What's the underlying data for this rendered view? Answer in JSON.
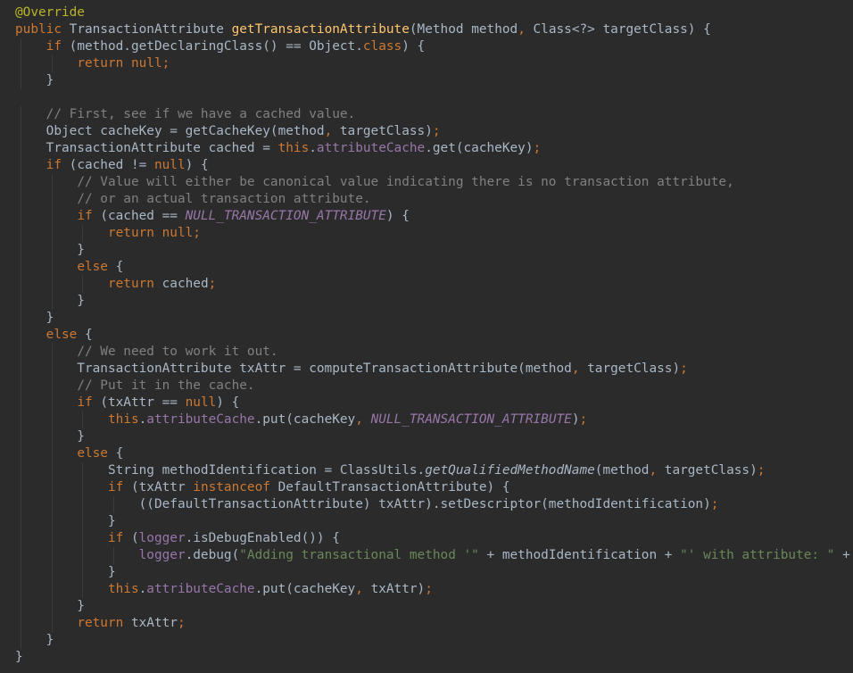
{
  "editor": {
    "language": "Java",
    "theme_colors": {
      "background": "#2b2b2b",
      "plain": "#a9b7c6",
      "keyword": "#cc7832",
      "annotation": "#bbb529",
      "method_declaration": "#ffc66d",
      "field": "#9876aa",
      "string": "#6a8759",
      "comment": "#808080"
    },
    "lines": [
      [
        [
          "ann",
          "@Override"
        ]
      ],
      [
        [
          "kw",
          "public "
        ],
        [
          "plain",
          "TransactionAttribute "
        ],
        [
          "fn",
          "getTransactionAttribute"
        ],
        [
          "plain",
          "(Method method"
        ],
        [
          "punc",
          ", "
        ],
        [
          "plain",
          "Class<?> targetClass) {"
        ]
      ],
      [
        [
          "plain",
          "    "
        ],
        [
          "kw",
          "if "
        ],
        [
          "plain",
          "(method.getDeclaringClass() == Object."
        ],
        [
          "kw",
          "class"
        ],
        [
          "plain",
          ") {"
        ]
      ],
      [
        [
          "plain",
          "        "
        ],
        [
          "kw",
          "return null"
        ],
        [
          "punc",
          ";"
        ]
      ],
      [
        [
          "plain",
          "    }"
        ]
      ],
      [
        [
          "plain",
          ""
        ]
      ],
      [
        [
          "plain",
          "    "
        ],
        [
          "cmt",
          "// First, see if we have a cached value."
        ]
      ],
      [
        [
          "plain",
          "    Object cacheKey = getCacheKey(method"
        ],
        [
          "punc",
          ", "
        ],
        [
          "plain",
          "targetClass)"
        ],
        [
          "punc",
          ";"
        ]
      ],
      [
        [
          "plain",
          "    TransactionAttribute cached = "
        ],
        [
          "kw",
          "this"
        ],
        [
          "plain",
          "."
        ],
        [
          "field",
          "attributeCache"
        ],
        [
          "plain",
          ".get(cacheKey)"
        ],
        [
          "punc",
          ";"
        ]
      ],
      [
        [
          "plain",
          "    "
        ],
        [
          "kw",
          "if "
        ],
        [
          "plain",
          "(cached != "
        ],
        [
          "kw",
          "null"
        ],
        [
          "plain",
          ") {"
        ]
      ],
      [
        [
          "plain",
          "        "
        ],
        [
          "cmt",
          "// Value will either be canonical value indicating there is no transaction attribute,"
        ]
      ],
      [
        [
          "plain",
          "        "
        ],
        [
          "cmt",
          "// or an actual transaction attribute."
        ]
      ],
      [
        [
          "plain",
          "        "
        ],
        [
          "kw",
          "if "
        ],
        [
          "plain",
          "(cached == "
        ],
        [
          "const",
          "NULL_TRANSACTION_ATTRIBUTE"
        ],
        [
          "plain",
          ") {"
        ]
      ],
      [
        [
          "plain",
          "            "
        ],
        [
          "kw",
          "return null"
        ],
        [
          "punc",
          ";"
        ]
      ],
      [
        [
          "plain",
          "        }"
        ]
      ],
      [
        [
          "plain",
          "        "
        ],
        [
          "kw",
          "else "
        ],
        [
          "plain",
          "{"
        ]
      ],
      [
        [
          "plain",
          "            "
        ],
        [
          "kw",
          "return "
        ],
        [
          "plain",
          "cached"
        ],
        [
          "punc",
          ";"
        ]
      ],
      [
        [
          "plain",
          "        }"
        ]
      ],
      [
        [
          "plain",
          "    }"
        ]
      ],
      [
        [
          "plain",
          "    "
        ],
        [
          "kw",
          "else "
        ],
        [
          "plain",
          "{"
        ]
      ],
      [
        [
          "plain",
          "        "
        ],
        [
          "cmt",
          "// We need to work it out."
        ]
      ],
      [
        [
          "plain",
          "        TransactionAttribute txAttr = computeTransactionAttribute(method"
        ],
        [
          "punc",
          ", "
        ],
        [
          "plain",
          "targetClass)"
        ],
        [
          "punc",
          ";"
        ]
      ],
      [
        [
          "plain",
          "        "
        ],
        [
          "cmt",
          "// Put it in the cache."
        ]
      ],
      [
        [
          "plain",
          "        "
        ],
        [
          "kw",
          "if "
        ],
        [
          "plain",
          "(txAttr == "
        ],
        [
          "kw",
          "null"
        ],
        [
          "plain",
          ") {"
        ]
      ],
      [
        [
          "plain",
          "            "
        ],
        [
          "kw",
          "this"
        ],
        [
          "plain",
          "."
        ],
        [
          "field",
          "attributeCache"
        ],
        [
          "plain",
          ".put(cacheKey"
        ],
        [
          "punc",
          ", "
        ],
        [
          "const",
          "NULL_TRANSACTION_ATTRIBUTE"
        ],
        [
          "plain",
          ")"
        ],
        [
          "punc",
          ";"
        ]
      ],
      [
        [
          "plain",
          "        }"
        ]
      ],
      [
        [
          "plain",
          "        "
        ],
        [
          "kw",
          "else "
        ],
        [
          "plain",
          "{"
        ]
      ],
      [
        [
          "plain",
          "            String methodIdentification = ClassUtils."
        ],
        [
          "static",
          "getQualifiedMethodName"
        ],
        [
          "plain",
          "(method"
        ],
        [
          "punc",
          ", "
        ],
        [
          "plain",
          "targetClass)"
        ],
        [
          "punc",
          ";"
        ]
      ],
      [
        [
          "plain",
          "            "
        ],
        [
          "kw",
          "if "
        ],
        [
          "plain",
          "(txAttr "
        ],
        [
          "kw",
          "instanceof "
        ],
        [
          "plain",
          "DefaultTransactionAttribute) {"
        ]
      ],
      [
        [
          "plain",
          "                ((DefaultTransactionAttribute) txAttr).setDescriptor(methodIdentification)"
        ],
        [
          "punc",
          ";"
        ]
      ],
      [
        [
          "plain",
          "            }"
        ]
      ],
      [
        [
          "plain",
          "            "
        ],
        [
          "kw",
          "if "
        ],
        [
          "plain",
          "("
        ],
        [
          "field",
          "logger"
        ],
        [
          "plain",
          ".isDebugEnabled()) {"
        ]
      ],
      [
        [
          "plain",
          "                "
        ],
        [
          "field",
          "logger"
        ],
        [
          "plain",
          ".debug("
        ],
        [
          "str",
          "\"Adding transactional method '\""
        ],
        [
          "plain",
          " + methodIdentification + "
        ],
        [
          "str",
          "\"' with attribute: \""
        ],
        [
          "plain",
          " + txAttr)"
        ],
        [
          "punc",
          ";"
        ]
      ],
      [
        [
          "plain",
          "            }"
        ]
      ],
      [
        [
          "plain",
          "            "
        ],
        [
          "kw",
          "this"
        ],
        [
          "plain",
          "."
        ],
        [
          "field",
          "attributeCache"
        ],
        [
          "plain",
          ".put(cacheKey"
        ],
        [
          "punc",
          ", "
        ],
        [
          "plain",
          "txAttr)"
        ],
        [
          "punc",
          ";"
        ]
      ],
      [
        [
          "plain",
          "        }"
        ]
      ],
      [
        [
          "plain",
          "        "
        ],
        [
          "kw",
          "return "
        ],
        [
          "plain",
          "txAttr"
        ],
        [
          "punc",
          ";"
        ]
      ],
      [
        [
          "plain",
          "    }"
        ]
      ],
      [
        [
          "plain",
          "}"
        ]
      ]
    ]
  }
}
